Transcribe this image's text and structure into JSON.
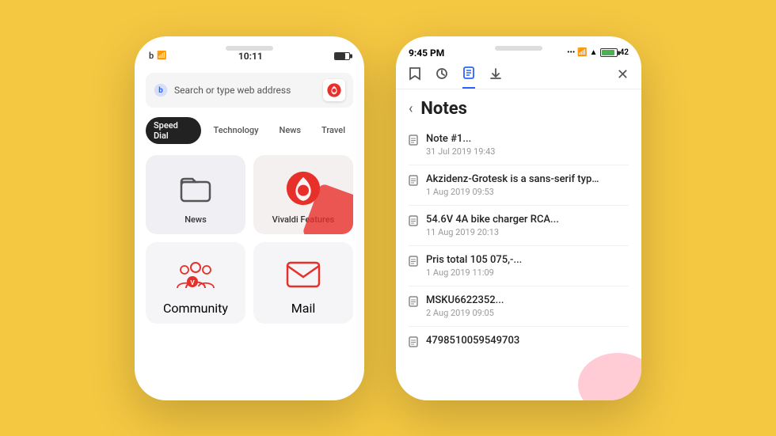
{
  "background": "#F5C842",
  "left_phone": {
    "status": {
      "icons_left": "🌐 📶",
      "time": "10:11",
      "battery": "80%"
    },
    "search_bar": {
      "placeholder": "Search or type web address"
    },
    "tabs": [
      {
        "label": "Speed Dial",
        "active": true
      },
      {
        "label": "Technology",
        "active": false
      },
      {
        "label": "News",
        "active": false
      },
      {
        "label": "Travel",
        "active": false
      }
    ],
    "speed_dial_items": [
      {
        "label": "News",
        "icon": "folder"
      },
      {
        "label": "Vivaldi Features",
        "icon": "vivaldi"
      },
      {
        "label": "Community",
        "icon": "people"
      },
      {
        "label": "Mail",
        "icon": "mail"
      }
    ]
  },
  "right_phone": {
    "status": {
      "time": "9:45 PM",
      "icons": "... 📶 WiFi 42"
    },
    "toolbar": {
      "bookmark_icon": "🔖",
      "history_icon": "🕐",
      "notes_icon": "📋",
      "download_icon": "⬇",
      "close_icon": "✕"
    },
    "notes_title": "Notes",
    "notes": [
      {
        "title": "Note #1...",
        "date": "31 Jul 2019 19:43"
      },
      {
        "title": "Akzidenz-Grotesk is a sans-serif typeface ...",
        "date": "1 Aug 2019 09:53"
      },
      {
        "title": "54.6V 4A bike charger RCA...",
        "date": "11 Aug 2019 20:13"
      },
      {
        "title": "Pris total 105 075,-...",
        "date": "1 Aug 2019 11:09"
      },
      {
        "title": "MSKU6622352...",
        "date": "2 Aug 2019 09:05"
      },
      {
        "title": "4798510059549703",
        "date": ""
      }
    ]
  }
}
